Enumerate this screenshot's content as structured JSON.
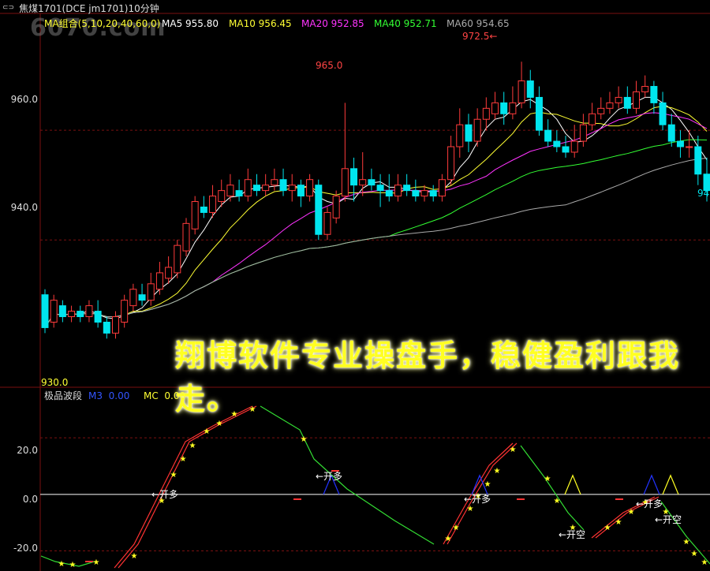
{
  "header": {
    "icon": "link-icon",
    "title": "焦煤1701(DCE jm1701)10分钟"
  },
  "watermark": "6070.com",
  "ma_legend": {
    "label": "MA组合(5,10,20,40,60,0)",
    "items": [
      {
        "label": "MA5",
        "value": "955.80",
        "color": "#ffffff"
      },
      {
        "label": "MA10",
        "value": "956.45",
        "color": "#ffff33"
      },
      {
        "label": "MA20",
        "value": "952.85",
        "color": "#ff33ff"
      },
      {
        "label": "MA40",
        "value": "952.71",
        "color": "#33ff33"
      },
      {
        "label": "MA60",
        "value": "954.65",
        "color": "#aaaaaa"
      }
    ]
  },
  "price_axis": {
    "ticks": [
      "960.0",
      "940.0"
    ]
  },
  "annotations": {
    "high_label": "972.5",
    "local_high": "965.0",
    "right_cut": "94",
    "low_label": "930.0"
  },
  "banner": "翔博软件专业操盘手，稳健盈利跟我走。",
  "indicator": {
    "name": "极品波段",
    "m3_label": "M3",
    "m3_value": "0.00",
    "mc_label": "MC",
    "mc_value": "0.00",
    "ticks": [
      "20.0",
      "0.0",
      "-20.0"
    ],
    "signals": [
      {
        "text": "←开多"
      },
      {
        "text": "←开多"
      },
      {
        "text": "←开多"
      },
      {
        "text": "←开空"
      },
      {
        "text": "←开多"
      },
      {
        "text": "←开空"
      }
    ]
  },
  "colors": {
    "up": "#ff3b3b",
    "down": "#00e5ee",
    "grid": "#7a1010",
    "ma5": "#ffffff",
    "ma10": "#ffff33",
    "ma20": "#ff33ff",
    "ma40": "#33ff33",
    "ma60": "#aaaaaa",
    "accent": "#ffff22"
  },
  "chart_data": {
    "type": "candlestick",
    "ylim": [
      915,
      978
    ],
    "y_gridlines": [
      960,
      940
    ],
    "candles": [
      [
        930,
        924,
        931,
        923
      ],
      [
        925,
        929,
        930,
        924
      ],
      [
        928,
        926,
        929,
        925
      ],
      [
        926,
        927,
        928,
        925
      ],
      [
        927,
        926,
        928,
        925
      ],
      [
        926,
        928,
        929,
        925
      ],
      [
        927,
        925,
        929,
        924
      ],
      [
        925,
        923,
        926,
        922
      ],
      [
        923,
        926,
        927,
        922
      ],
      [
        925,
        929,
        930,
        924
      ],
      [
        928,
        931,
        932,
        927
      ],
      [
        930,
        929,
        932,
        928
      ],
      [
        929,
        932,
        934,
        928
      ],
      [
        931,
        934,
        936,
        930
      ],
      [
        933,
        935,
        937,
        932
      ],
      [
        934,
        939,
        940,
        933
      ],
      [
        938,
        943,
        944,
        937
      ],
      [
        942,
        947,
        948,
        941
      ],
      [
        946,
        945,
        948,
        944
      ],
      [
        945,
        948,
        950,
        944
      ],
      [
        947,
        949,
        951,
        946
      ],
      [
        948,
        950,
        952,
        947
      ],
      [
        949,
        948,
        951,
        947
      ],
      [
        948,
        951,
        953,
        947
      ],
      [
        950,
        949,
        952,
        948
      ],
      [
        949,
        950,
        952,
        948
      ],
      [
        950,
        951,
        953,
        949
      ],
      [
        951,
        949,
        953,
        948
      ],
      [
        949,
        950,
        952,
        947
      ],
      [
        950,
        948,
        951,
        946
      ],
      [
        948,
        951,
        952,
        947
      ],
      [
        950,
        941,
        951,
        940
      ],
      [
        941,
        945,
        946,
        940
      ],
      [
        944,
        948,
        949,
        943
      ],
      [
        948,
        953,
        965,
        947
      ],
      [
        953,
        950,
        955,
        947
      ],
      [
        950,
        951,
        956,
        948
      ],
      [
        951,
        950,
        953,
        949
      ],
      [
        950,
        949,
        952,
        946
      ],
      [
        949,
        948,
        952,
        947
      ],
      [
        948,
        950,
        952,
        947
      ],
      [
        950,
        949,
        952,
        948
      ],
      [
        949,
        948,
        951,
        947
      ],
      [
        948,
        949,
        950,
        947
      ],
      [
        949,
        948,
        950,
        947
      ],
      [
        948,
        951,
        952,
        947
      ],
      [
        951,
        957,
        959,
        950
      ],
      [
        957,
        961,
        964,
        955
      ],
      [
        961,
        958,
        963,
        956
      ],
      [
        958,
        962,
        964,
        957
      ],
      [
        962,
        964,
        966,
        960
      ],
      [
        963,
        965,
        967,
        962
      ],
      [
        965,
        963,
        967,
        961
      ],
      [
        963,
        965,
        968,
        962
      ],
      [
        965,
        969,
        972.5,
        964
      ],
      [
        969,
        966,
        971,
        964
      ],
      [
        966,
        960,
        968,
        959
      ],
      [
        960,
        958,
        962,
        957
      ],
      [
        958,
        957,
        960,
        956
      ],
      [
        957,
        956,
        959,
        955
      ],
      [
        956,
        958,
        961,
        955
      ],
      [
        958,
        961,
        963,
        957
      ],
      [
        961,
        963,
        965,
        960
      ],
      [
        963,
        964,
        966,
        962
      ],
      [
        964,
        965,
        967,
        963
      ],
      [
        965,
        966,
        968,
        964
      ],
      [
        966,
        964,
        968,
        963
      ],
      [
        964,
        967,
        969,
        963
      ],
      [
        967,
        968,
        970,
        966
      ],
      [
        968,
        965,
        969,
        963
      ],
      [
        965,
        961,
        967,
        960
      ],
      [
        961,
        958,
        963,
        957
      ],
      [
        958,
        957,
        960,
        955
      ],
      [
        957,
        957,
        960,
        955
      ],
      [
        957,
        952,
        959,
        950
      ],
      [
        952,
        949,
        955,
        947
      ]
    ],
    "indicator": {
      "ylim": [
        -26,
        34
      ],
      "gridlines": [
        20,
        0,
        -20
      ]
    }
  }
}
